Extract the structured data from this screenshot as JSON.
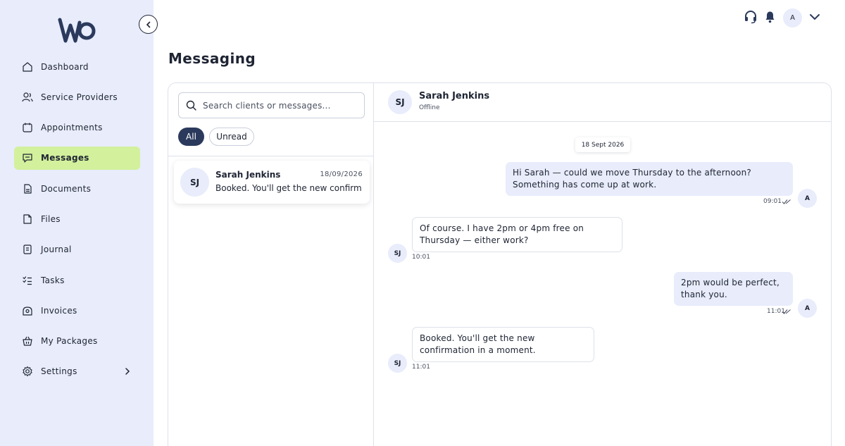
{
  "brand": {
    "logo_icon": "wo-logo-icon"
  },
  "sidebar": {
    "items": [
      {
        "label": "Dashboard",
        "icon": "home-icon"
      },
      {
        "label": "Service Providers",
        "icon": "users-icon"
      },
      {
        "label": "Appointments",
        "icon": "calendar-icon"
      },
      {
        "label": "Messages",
        "icon": "chat-icon",
        "active": true
      },
      {
        "label": "Documents",
        "icon": "document-icon"
      },
      {
        "label": "Files",
        "icon": "file-icon"
      },
      {
        "label": "Journal",
        "icon": "journal-icon"
      },
      {
        "label": "Tasks",
        "icon": "tasks-icon"
      },
      {
        "label": "Invoices",
        "icon": "invoice-icon"
      },
      {
        "label": "My Packages",
        "icon": "package-icon"
      },
      {
        "label": "Settings",
        "icon": "gear-icon"
      }
    ],
    "active_color": "#d3f09c",
    "bg_color": "#e8ecfb"
  },
  "topbar": {
    "avatar_initial": "A"
  },
  "page": {
    "title": "Messaging"
  },
  "conversations": {
    "search_placeholder": "Search clients or messages...",
    "filters": [
      "All",
      "Unread"
    ],
    "active_filter": "All",
    "items": [
      {
        "initials": "SJ",
        "name": "Sarah Jenkins",
        "date": "18/09/2026",
        "preview": "Booked. You'll get the new confirmation in a moment."
      }
    ]
  },
  "chat": {
    "contact_initials": "SJ",
    "contact_name": "Sarah Jenkins",
    "contact_status": "Offline",
    "date_separator": "18 Sept 2026",
    "messages": [
      {
        "direction": "out",
        "text": "Hi Sarah — could we move Thursday to the afternoon? Something has come up at work.",
        "time": "09:01",
        "avatar": "A"
      },
      {
        "direction": "in",
        "text": "Of course. I have 2pm or 4pm free on Thursday — either work?",
        "time": "10:01",
        "avatar": "SJ"
      },
      {
        "direction": "out",
        "text": "2pm would be perfect, thank you.",
        "time": "11:01",
        "avatar": "A"
      },
      {
        "direction": "in",
        "text": "Booked. You'll get the new confirmation in a moment.",
        "time": "11:01",
        "avatar": "SJ"
      }
    ]
  }
}
